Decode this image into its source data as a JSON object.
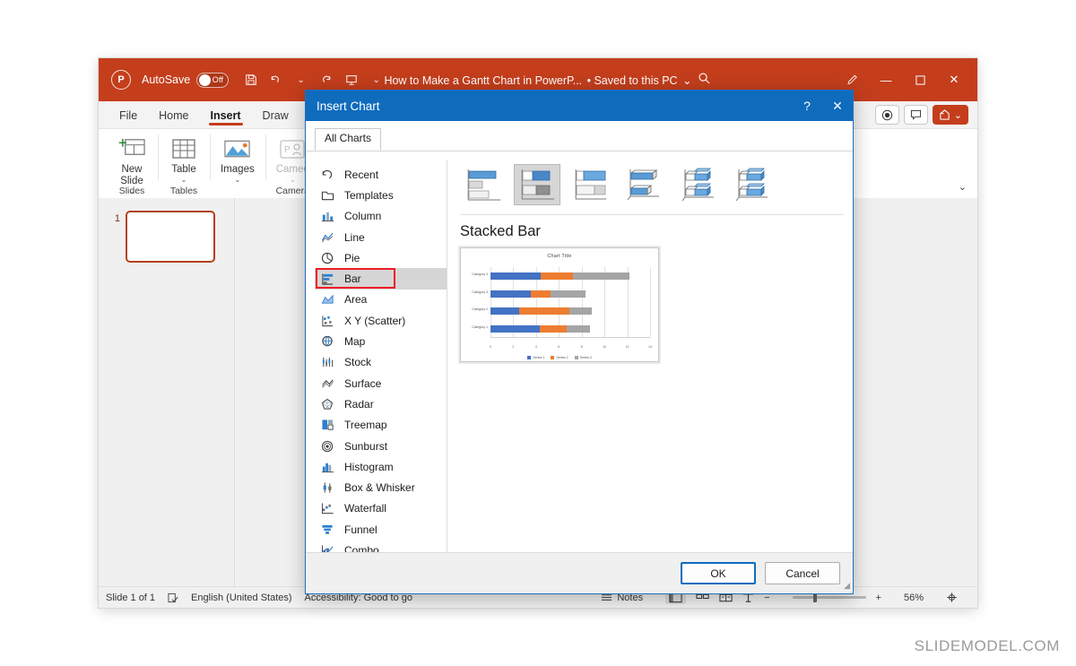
{
  "app": {
    "autosave_label": "AutoSave",
    "autosave_state": "Off",
    "document_title": "How to Make a Gantt Chart in PowerP...",
    "save_state": "• Saved to this PC",
    "logo_text": "P",
    "accent_color": "#c43e1c",
    "dialog_accent_color": "#0f6cbd",
    "annotation_color": "#ee1c25"
  },
  "quick_access": [
    {
      "name": "save-icon",
      "glyph": "὚B"
    },
    {
      "name": "undo-icon",
      "glyph": "↶"
    },
    {
      "name": "redo-icon",
      "glyph": "↷"
    },
    {
      "name": "present-icon",
      "glyph": "▷"
    },
    {
      "name": "customize-qat-icon",
      "glyph": "⌄"
    }
  ],
  "window_controls": {
    "pen": "✎",
    "minimize": "—",
    "maximize": "☐",
    "close": "✕",
    "search": "⌕"
  },
  "ribbon": {
    "tabs": [
      {
        "label": "File",
        "active": false
      },
      {
        "label": "Home",
        "active": false
      },
      {
        "label": "Insert",
        "active": true
      },
      {
        "label": "Draw",
        "active": false
      }
    ],
    "groups": [
      {
        "label": "New\nSlide",
        "caret": "⌄",
        "footer": "Slides",
        "disabled": false
      },
      {
        "label": "Table",
        "caret": "⌄",
        "footer": "Tables",
        "disabled": false
      },
      {
        "label": "Images",
        "caret": "⌄",
        "footer": "",
        "disabled": false
      },
      {
        "label": "Cameo",
        "caret": "⌄",
        "footer": "Camera",
        "disabled": true
      }
    ],
    "right_buttons": [
      {
        "name": "record-button",
        "label": "◉"
      },
      {
        "name": "comments-button",
        "label": "὞9"
      }
    ],
    "share_label": "↪",
    "share_caret": "⌄",
    "collapse_icon": "⌄"
  },
  "thumbnails": [
    {
      "number": "1",
      "selected": true
    }
  ],
  "status_bar": {
    "slide_count": "Slide 1 of 1",
    "accessibility_icon": "☑",
    "language": "English (United States)",
    "accessibility": "Accessibility: Good to go",
    "notes_label": "Notes",
    "view_buttons": [
      "normal-view",
      "slide-sorter-view",
      "reading-view",
      "presenter-view"
    ],
    "zoom_out": "−",
    "zoom_in": "+",
    "zoom_level": "56%",
    "fit_icon": "⌖"
  },
  "dialog": {
    "title": "Insert Chart",
    "help_icon": "?",
    "close_icon": "✕",
    "tabs": [
      {
        "label": "All Charts",
        "active": true
      }
    ],
    "chart_types": [
      {
        "label": "Recent",
        "icon": "recent-icon",
        "selected": false
      },
      {
        "label": "Templates",
        "icon": "templates-icon",
        "selected": false
      },
      {
        "label": "Column",
        "icon": "column-icon",
        "selected": false
      },
      {
        "label": "Line",
        "icon": "line-icon",
        "selected": false
      },
      {
        "label": "Pie",
        "icon": "pie-icon",
        "selected": false
      },
      {
        "label": "Bar",
        "icon": "bar-icon",
        "selected": true,
        "annotated": true
      },
      {
        "label": "Area",
        "icon": "area-icon",
        "selected": false
      },
      {
        "label": "X Y (Scatter)",
        "icon": "scatter-icon",
        "selected": false
      },
      {
        "label": "Map",
        "icon": "map-icon",
        "selected": false
      },
      {
        "label": "Stock",
        "icon": "stock-icon",
        "selected": false
      },
      {
        "label": "Surface",
        "icon": "surface-icon",
        "selected": false
      },
      {
        "label": "Radar",
        "icon": "radar-icon",
        "selected": false
      },
      {
        "label": "Treemap",
        "icon": "treemap-icon",
        "selected": false
      },
      {
        "label": "Sunburst",
        "icon": "sunburst-icon",
        "selected": false
      },
      {
        "label": "Histogram",
        "icon": "histogram-icon",
        "selected": false
      },
      {
        "label": "Box & Whisker",
        "icon": "box-whisker-icon",
        "selected": false
      },
      {
        "label": "Waterfall",
        "icon": "waterfall-icon",
        "selected": false
      },
      {
        "label": "Funnel",
        "icon": "funnel-icon",
        "selected": false
      },
      {
        "label": "Combo",
        "icon": "combo-icon",
        "selected": false
      }
    ],
    "subtypes": [
      {
        "name": "clustered-bar",
        "selected": false
      },
      {
        "name": "stacked-bar",
        "selected": true
      },
      {
        "name": "100-percent-stacked-bar",
        "selected": false
      },
      {
        "name": "3d-clustered-bar",
        "selected": false
      },
      {
        "name": "3d-stacked-bar",
        "selected": false
      },
      {
        "name": "3d-100-percent-stacked-bar",
        "selected": false
      }
    ],
    "preview_title": "Stacked Bar",
    "ok_label": "OK",
    "cancel_label": "Cancel"
  },
  "chart_data": {
    "type": "bar",
    "orientation": "horizontal",
    "stacked": true,
    "title": "Chart Title",
    "categories": [
      "Category 1",
      "Category 2",
      "Category 3",
      "Category 4"
    ],
    "series": [
      {
        "name": "Series 1",
        "color": "#4472c4",
        "values": [
          4.3,
          2.5,
          3.5,
          4.4
        ]
      },
      {
        "name": "Series 2",
        "color": "#ed7d31",
        "values": [
          2.4,
          4.4,
          1.8,
          2.8
        ]
      },
      {
        "name": "Series 3",
        "color": "#a5a5a5",
        "values": [
          2.0,
          2.0,
          3.0,
          5.0
        ]
      }
    ],
    "xticks": [
      0,
      2,
      4,
      6,
      8,
      10,
      12,
      14
    ],
    "xlim": [
      0,
      14
    ],
    "xlabel": "",
    "ylabel": "",
    "grid": true,
    "legend_position": "bottom"
  },
  "watermark": "SLIDEMODEL.COM"
}
